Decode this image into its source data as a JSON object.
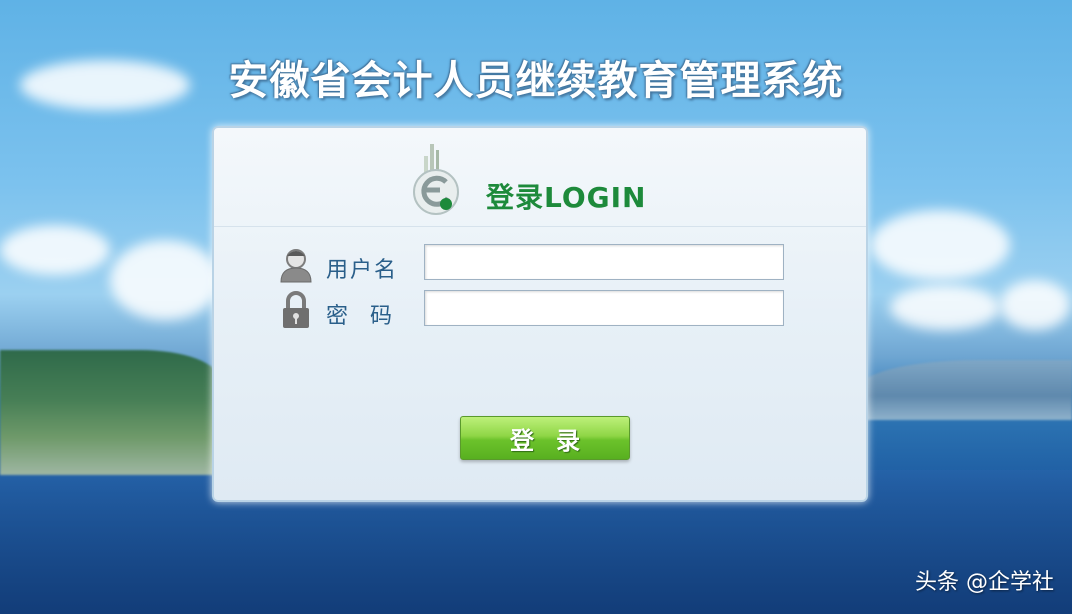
{
  "app": {
    "title": "安徽省会计人员继续教育管理系统"
  },
  "login_panel": {
    "heading": "登录LOGIN",
    "username": {
      "label": "用户名",
      "value": "",
      "icon": "user-icon"
    },
    "password": {
      "label": "密码",
      "value": "",
      "icon": "lock-icon"
    },
    "submit_label": "登录"
  },
  "watermark": "头条 @企学社",
  "colors": {
    "heading_green": "#1d8a3b",
    "button_green": "#6cc22b",
    "label_blue": "#2a5f8a"
  }
}
